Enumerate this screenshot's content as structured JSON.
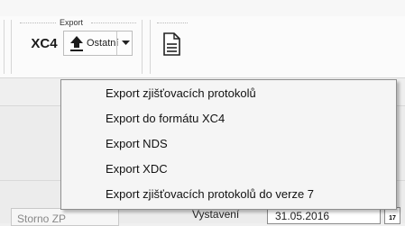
{
  "ribbon": {
    "group_label": "Export",
    "xc4_label": "XC4",
    "other_label": "Ostatní"
  },
  "menu": {
    "items": [
      {
        "label": "Export zjišťovacích protokolů"
      },
      {
        "label": "Export do formátu XC4"
      },
      {
        "label": "Export NDS"
      },
      {
        "label": "Export XDC"
      },
      {
        "label": "Export zjišťovacích protokolů do verze 7"
      }
    ]
  },
  "form": {
    "storno_placeholder": "Storno ZP",
    "issued_label": "Vystavení",
    "issued_date": "31.05.2016",
    "calendar_day": "17"
  }
}
